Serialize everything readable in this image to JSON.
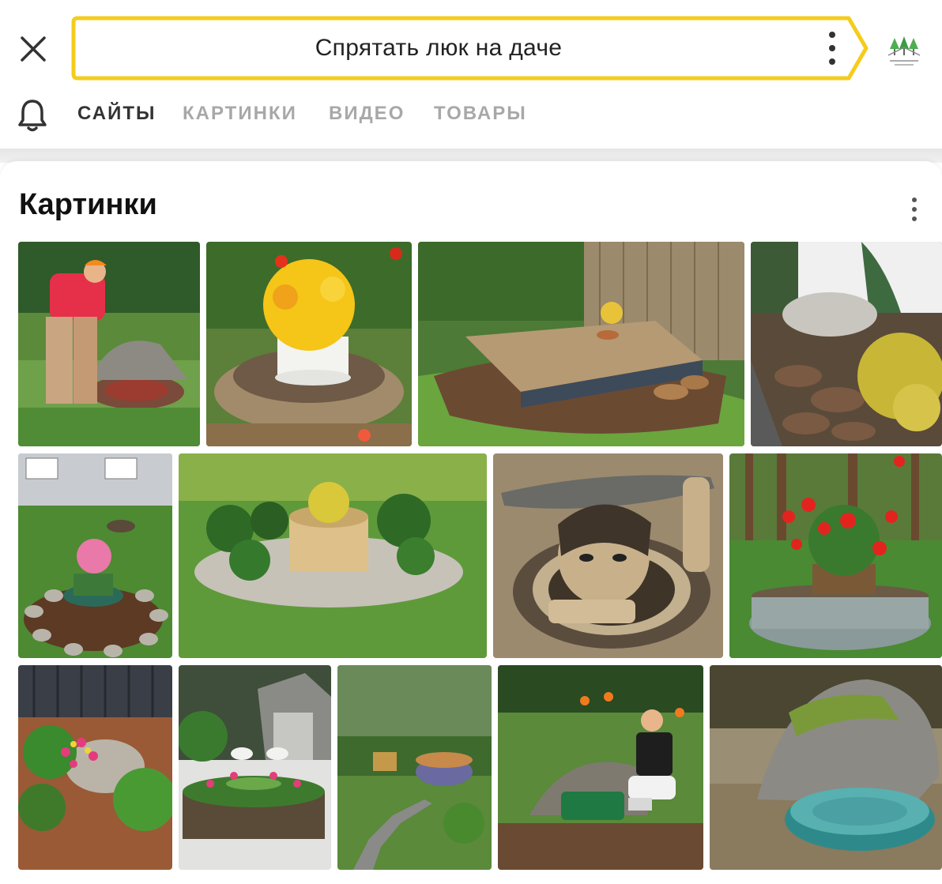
{
  "search": {
    "query": "Спрятать люк на даче"
  },
  "tabs": [
    {
      "label": "САЙТЫ",
      "active": true
    },
    {
      "label": "КАРТИНКИ",
      "active": false
    },
    {
      "label": "ВИДЕО",
      "active": false
    },
    {
      "label": "ТОВАРЫ",
      "active": false
    }
  ],
  "section": {
    "title": "Картинки"
  },
  "colors": {
    "search_border": "#f5cc1d",
    "active_tab": "#333333",
    "inactive_tab": "#a8a8a8"
  },
  "icons": {
    "close": "close-icon",
    "menu": "more-vertical-icon",
    "notifications": "bell-icon",
    "site": "site-logo-icon"
  },
  "images": [
    {
      "subject": "man lifting artificial rock over well hatch"
    },
    {
      "subject": "flower pot on log-ringed hatch bed"
    },
    {
      "subject": "wooden deck platform in garden"
    },
    {
      "subject": "boulder in mulched garden bed"
    },
    {
      "subject": "hatch flower bed ringed with stones"
    },
    {
      "subject": "planter among round shrubs on gravel"
    },
    {
      "subject": "gnome figure lifting manhole cover"
    },
    {
      "subject": "red geraniums in basket on stone ring"
    },
    {
      "subject": "rock among bark mulch and flowers"
    },
    {
      "subject": "round raised bed with flowers by stairs"
    },
    {
      "subject": "decorated hatch in garden with path"
    },
    {
      "subject": "woman with fake rock cover over green well"
    },
    {
      "subject": "mossy rock over turquoise hatch"
    }
  ]
}
